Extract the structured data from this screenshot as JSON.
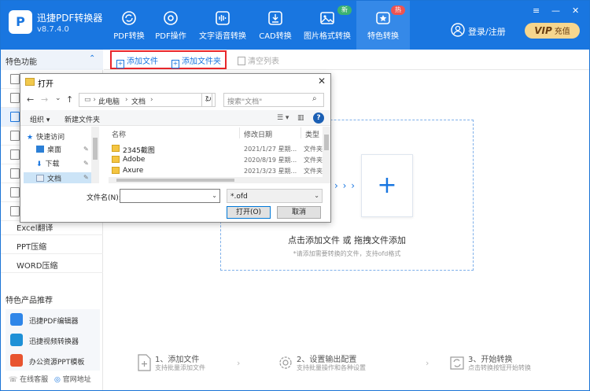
{
  "app": {
    "logo_text": "P",
    "name": "迅捷PDF转换器",
    "version": "v8.7.4.0"
  },
  "nav": [
    {
      "label": "PDF转换",
      "icon": "refresh-circle-icon"
    },
    {
      "label": "PDF操作",
      "icon": "gear-circle-icon"
    },
    {
      "label": "文字语音转换",
      "icon": "audio-wave-icon"
    },
    {
      "label": "CAD转换",
      "icon": "download-box-icon"
    },
    {
      "label": "图片格式转换",
      "icon": "image-icon",
      "badge": "新"
    },
    {
      "label": "特色转换",
      "icon": "star-box-icon",
      "badge": "热",
      "active": true
    }
  ],
  "window": {
    "menu": "≡",
    "minimize": "—",
    "close": "✕"
  },
  "user": {
    "login_label": "登录/注册"
  },
  "vip": {
    "badge": "VIP",
    "label": "充值"
  },
  "sidebar": {
    "title": "特色功能",
    "items": [
      {
        "label": ""
      },
      {
        "label": ""
      },
      {
        "label": ""
      },
      {
        "label": ""
      },
      {
        "label": ""
      },
      {
        "label": ""
      },
      {
        "label": ""
      },
      {
        "label": ""
      },
      {
        "label": "Excel翻译"
      },
      {
        "label": "PPT压缩"
      },
      {
        "label": "WORD压缩"
      }
    ],
    "recommend_title": "特色产品推荐",
    "recommend": [
      {
        "label": "迅捷PDF编辑器",
        "color": "#2f86e8"
      },
      {
        "label": "迅捷视频转换器",
        "color": "#1e90d6"
      },
      {
        "label": "办公资源PPT模板",
        "color": "#e8542f"
      }
    ],
    "footer": {
      "service": "在线客服",
      "site": "官网地址"
    }
  },
  "toolbar": {
    "add_file": "添加文件",
    "add_folder": "添加文件夹",
    "clear_list": "清空列表"
  },
  "dropzone": {
    "arrows": "› › ›",
    "plus": "+",
    "main": "点击添加文件 或 拖拽文件添加",
    "sub": "*请添加需要转换的文件，支持ofd格式"
  },
  "steps": [
    {
      "title": "1、添加文件",
      "desc": "支持批量添加文件"
    },
    {
      "title": "2、设置输出配置",
      "desc": "支持批量操作和各种设置"
    },
    {
      "title": "3、开始转换",
      "desc": "点击转换按钮开始转换"
    }
  ],
  "dialog": {
    "title": "打开",
    "close": "✕",
    "back": "←",
    "forward": "→",
    "recent": "⌄",
    "up": "↑",
    "breadcrumb": [
      "此电脑",
      "文档"
    ],
    "refresh": "↻",
    "search_placeholder": "搜索\"文档\"",
    "organize": "组织 ▾",
    "new_folder": "新建文件夹",
    "help": "?",
    "quick_access": [
      {
        "label": "快速访问"
      },
      {
        "label": "桌面"
      },
      {
        "label": "下载"
      },
      {
        "label": "文档"
      }
    ],
    "columns": {
      "name": "名称",
      "date": "修改日期",
      "type": "类型"
    },
    "files": [
      {
        "name": "2345截图",
        "date": "2021/1/27 星期...",
        "type": "文件夹"
      },
      {
        "name": "Adobe",
        "date": "2020/8/19 星期...",
        "type": "文件夹"
      },
      {
        "name": "Axure",
        "date": "2021/3/23 星期...",
        "type": "文件夹"
      }
    ],
    "filename_label": "文件名(N):",
    "filename_value": "",
    "filter_value": "*.ofd",
    "open_button": "打开(O)",
    "cancel_button": "取消"
  }
}
